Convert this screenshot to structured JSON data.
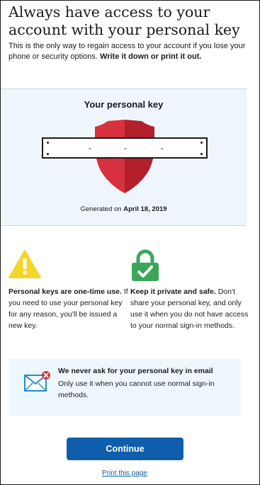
{
  "page": {
    "title": "Always have access to your account with your personal key",
    "intro_text": "This is the only way to regain access to your account if you lose your phone or security options.",
    "intro_emphasis": "Write it down or print it out."
  },
  "key_panel": {
    "heading": "Your personal key",
    "key_segments": [
      "",
      "",
      "",
      ""
    ],
    "dash": "-",
    "generated_prefix": "Generated on",
    "generated_date": "April 18, 2019"
  },
  "tips": [
    {
      "icon": "warning-icon",
      "bold": "Personal keys are one-time use.",
      "text": " If you need to use your personal key for any reason, you'll be issued a new key."
    },
    {
      "icon": "lock-icon",
      "bold": "Keep it private and safe.",
      "text": " Don't share your personal key, and only use it when you do not have access to your normal sign-in methods."
    }
  ],
  "notice": {
    "icon": "mail-icon",
    "title": "We never ask for your personal key in email",
    "body": "Only use it when you cannot use normal sign-in methods."
  },
  "actions": {
    "continue_label": "Continue",
    "print_label": "Print this page"
  },
  "colors": {
    "accent": "#0f5eab",
    "shield_red": "#cf2a38",
    "warning_yellow": "#f5d52a",
    "success_green": "#3aa65a",
    "panel_bg": "#eef6fb",
    "notice_bg": "#eef8fc"
  }
}
